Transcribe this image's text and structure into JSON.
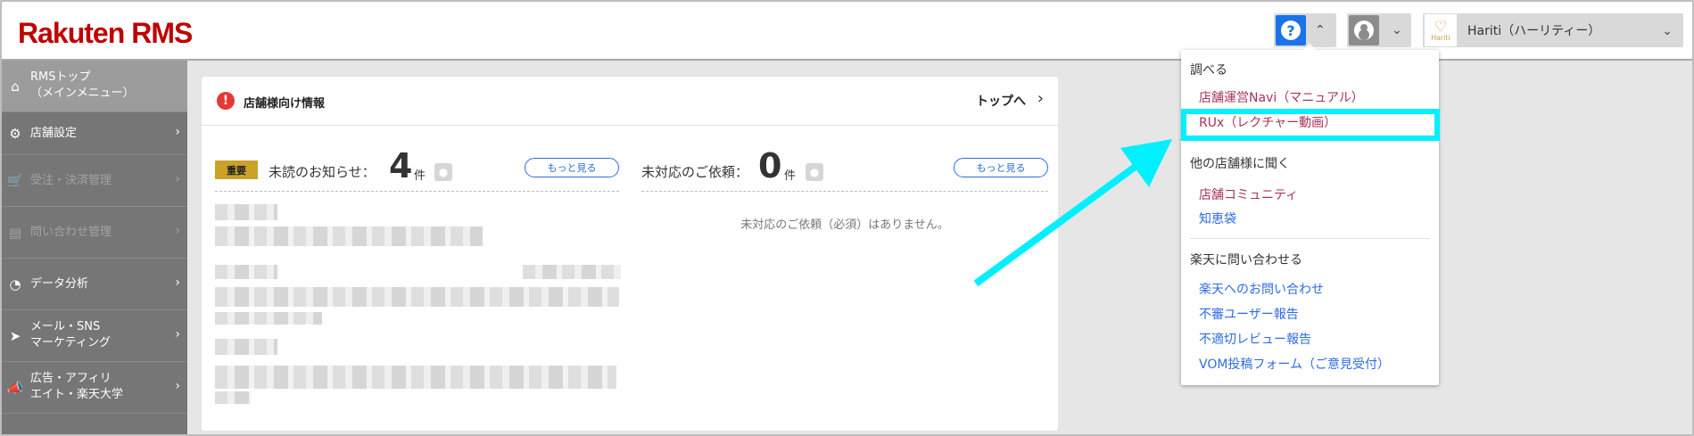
{
  "header": {
    "logo_brand": "Rakuten",
    "logo_product": "RMS",
    "store_name": "Hariti（ハーリティー）",
    "store_logo_text": "Hariti"
  },
  "sidebar": {
    "items": [
      {
        "label_line1": "RMSトップ",
        "label_line2": "（メインメニュー）",
        "icon": "home-icon"
      },
      {
        "label_line1": "店舗設定",
        "label_line2": "",
        "icon": "gear-icon"
      },
      {
        "label_line1": "受注・決済管理",
        "label_line2": "",
        "icon": "cart-icon"
      },
      {
        "label_line1": "問い合わせ管理",
        "label_line2": "",
        "icon": "chat-icon"
      },
      {
        "label_line1": "データ分析",
        "label_line2": "",
        "icon": "pie-chart-icon"
      },
      {
        "label_line1": "メール・SNS",
        "label_line2": "マーケティング",
        "icon": "send-icon"
      },
      {
        "label_line1": "広告・アフィリ",
        "label_line2": "エイト・楽天大学",
        "icon": "megaphone-icon"
      }
    ]
  },
  "main": {
    "card_title": "店舗様向け情報",
    "top_link": "トップへ",
    "notices": {
      "badge": "重要",
      "label": "未読のお知らせ：",
      "count": "4",
      "unit": "件",
      "more": "もっと見る"
    },
    "requests": {
      "label": "未対応のご依頼：",
      "count": "0",
      "unit": "件",
      "more": "もっと見る",
      "empty_message": "未対応のご依頼（必須）はありません。"
    }
  },
  "dropdown": {
    "section1_heading": "調べる",
    "section1_links": [
      "店舗運営Navi（マニュアル）",
      "RUx（レクチャー動画）"
    ],
    "section2_heading": "他の店舗様に聞く",
    "section2_links": [
      "店舗コミュニティ",
      "知恵袋"
    ],
    "section3_heading": "楽天に問い合わせる",
    "section3_links": [
      "楽天へのお問い合わせ",
      "不審ユーザー報告",
      "不適切レビュー報告",
      "VOM投稿フォーム（ご意見受付）"
    ]
  },
  "colors": {
    "brand_red": "#bf0000",
    "help_blue": "#1a73e8",
    "highlight_cyan": "#00f0ff",
    "link_red": "#a8325a",
    "link_blue": "#2d6de0",
    "badge_gold": "#c9a227"
  }
}
